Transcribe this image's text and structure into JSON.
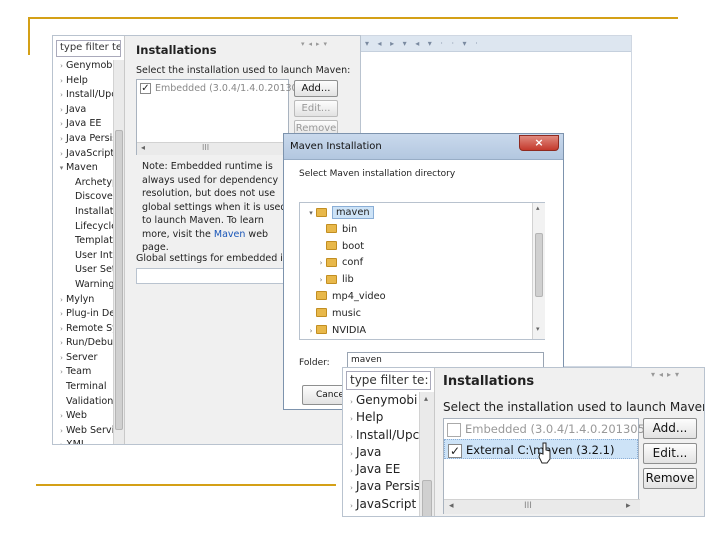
{
  "colors": {
    "accent_rule": "#d4a017",
    "dialog_close": "#c9453a",
    "dialog_title_bar": "#b7cbe4",
    "selection": "#cde3f7"
  },
  "back_window": {
    "filter_placeholder": "type filter te:",
    "tree": [
      {
        "label": "Genymobi",
        "arrow": "›"
      },
      {
        "label": "Help",
        "arrow": "›"
      },
      {
        "label": "Install/Upc",
        "arrow": "›"
      },
      {
        "label": "Java",
        "arrow": "›"
      },
      {
        "label": "Java EE",
        "arrow": "›"
      },
      {
        "label": "Java Persis",
        "arrow": "›"
      },
      {
        "label": "JavaScript",
        "arrow": "›"
      },
      {
        "label": "Maven",
        "arrow": "▾"
      },
      {
        "label": "Archetyp",
        "arrow": ""
      },
      {
        "label": "Discover",
        "arrow": ""
      },
      {
        "label": "Installati",
        "arrow": ""
      },
      {
        "label": "Lifecycle",
        "arrow": ""
      },
      {
        "label": "Templat",
        "arrow": ""
      },
      {
        "label": "User Inte",
        "arrow": ""
      },
      {
        "label": "User Set",
        "arrow": ""
      },
      {
        "label": "Warning",
        "arrow": ""
      },
      {
        "label": "Mylyn",
        "arrow": "›"
      },
      {
        "label": "Plug-in De",
        "arrow": "›"
      },
      {
        "label": "Remote Sy",
        "arrow": "›"
      },
      {
        "label": "Run/Debu",
        "arrow": "›"
      },
      {
        "label": "Server",
        "arrow": "›"
      },
      {
        "label": "Team",
        "arrow": "›"
      },
      {
        "label": "Terminal",
        "arrow": ""
      },
      {
        "label": "Validation",
        "arrow": ""
      },
      {
        "label": "Web",
        "arrow": "›"
      },
      {
        "label": "Web Servi",
        "arrow": "›"
      },
      {
        "label": "XML",
        "arrow": "›"
      }
    ],
    "heading": "Installations",
    "instruction": "Select the installation used to launch Maven:",
    "installations": [
      {
        "label": "Embedded (3.0.4/1.4.0.201305",
        "checked": true
      }
    ],
    "buttons": {
      "add": "Add...",
      "edit": "Edit...",
      "remove": "Remove"
    },
    "note": "Note: Embedded runtime is always used for dependency resolution, but does not use global settings when it is used to launch Maven. To learn more, visit the",
    "note_link": "Maven",
    "note_tail": "web page.",
    "global_settings_label": "Global settings for embedded ins"
  },
  "dialog": {
    "title": "Maven Installation",
    "close": "×",
    "instruction": "Select Maven installation directory",
    "folders": [
      {
        "label": "maven",
        "indent": 0,
        "arrow": "▾",
        "selected": true
      },
      {
        "label": "bin",
        "indent": 1,
        "arrow": "",
        "selected": false
      },
      {
        "label": "boot",
        "indent": 1,
        "arrow": "",
        "selected": false
      },
      {
        "label": "conf",
        "indent": 1,
        "arrow": "›",
        "selected": false
      },
      {
        "label": "lib",
        "indent": 1,
        "arrow": "›",
        "selected": false
      },
      {
        "label": "mp4_video",
        "indent": 0,
        "arrow": "",
        "selected": false
      },
      {
        "label": "music",
        "indent": 0,
        "arrow": "",
        "selected": false
      },
      {
        "label": "NVIDIA",
        "indent": 0,
        "arrow": "›",
        "selected": false
      }
    ],
    "name_label": "Folder:",
    "name_value": "maven",
    "partial_button": "Cance"
  },
  "front_window": {
    "filter_placeholder": "type filter te:",
    "tree": [
      {
        "label": "Genymobi",
        "arrow": "›"
      },
      {
        "label": "Help",
        "arrow": "›"
      },
      {
        "label": "Install/Upc",
        "arrow": "›"
      },
      {
        "label": "Java",
        "arrow": "›"
      },
      {
        "label": "Java EE",
        "arrow": "›"
      },
      {
        "label": "Java Persis",
        "arrow": "›"
      },
      {
        "label": "JavaScript",
        "arrow": "›"
      }
    ],
    "heading": "Installations",
    "instruction": "Select the installation used to launch Maven:",
    "installations": [
      {
        "label": "Embedded (3.0.4/1.4.0.201305",
        "checked": false
      },
      {
        "label": "External C:\\maven (3.2.1)",
        "checked": true
      }
    ],
    "buttons": {
      "add": "Add...",
      "edit": "Edit...",
      "remove": "Remove"
    }
  }
}
